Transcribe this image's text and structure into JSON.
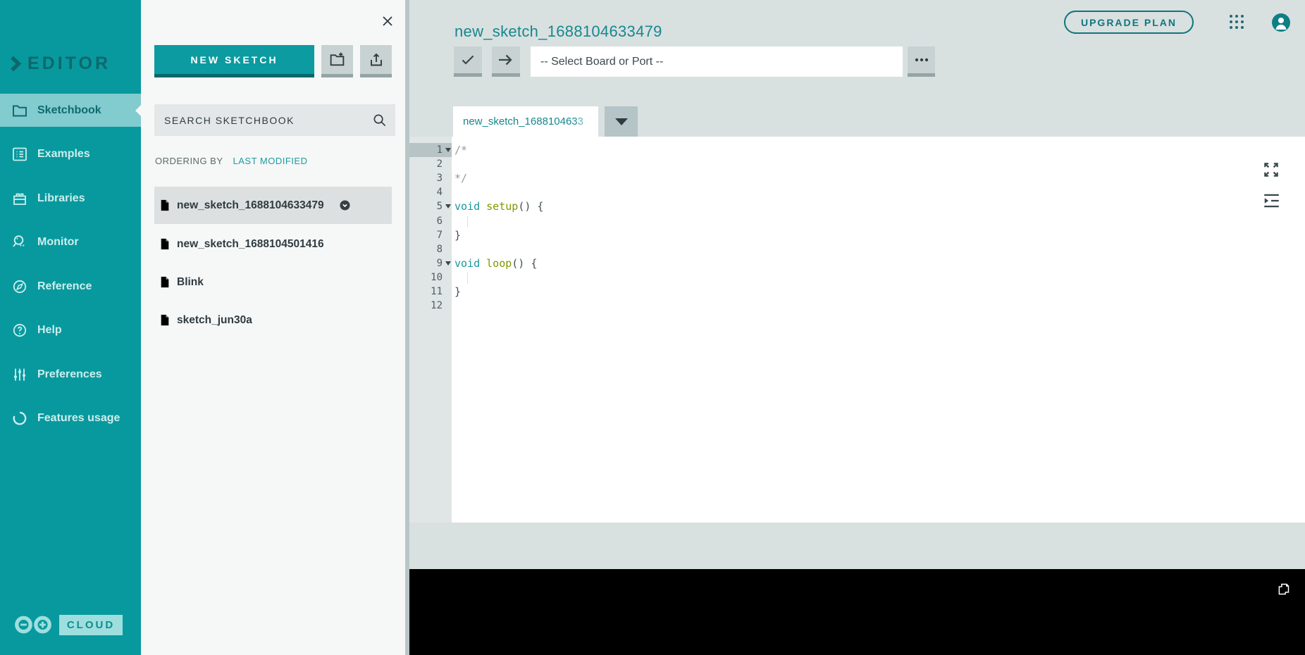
{
  "colors": {
    "sidebar_teal": "#08999e",
    "brand_teal": "#0b9ba0",
    "title_teal": "#16888d",
    "active_item_bg": "#82cbce",
    "main_bg": "#d9e0e0",
    "panel_bg": "#f6f7f7",
    "button_gray": "#c8d2d2",
    "console_black": "#000000",
    "code_keyword": "#17989d",
    "code_function": "#7d9a00",
    "code_comment": "#929c9c",
    "code_punct": "#434f54"
  },
  "sidebar": {
    "logo_text": "EDITOR",
    "items": [
      {
        "label": "Sketchbook",
        "icon": "folder-icon",
        "active": true
      },
      {
        "label": "Examples",
        "icon": "examples-icon"
      },
      {
        "label": "Libraries",
        "icon": "libraries-icon"
      },
      {
        "label": "Monitor",
        "icon": "monitor-icon"
      },
      {
        "label": "Reference",
        "icon": "reference-icon"
      },
      {
        "label": "Help",
        "icon": "help-icon"
      },
      {
        "label": "Preferences",
        "icon": "preferences-icon"
      },
      {
        "label": "Features usage",
        "icon": "features-usage-icon"
      }
    ],
    "cloud_badge": "CLOUD"
  },
  "panel": {
    "new_sketch_label": "NEW SKETCH",
    "search_placeholder": "SEARCH SKETCHBOOK",
    "ordering_label": "ORDERING BY",
    "ordering_value": "LAST MODIFIED",
    "sketches": [
      {
        "name": "new_sketch_1688104633479",
        "selected": true
      },
      {
        "name": "new_sketch_1688104501416",
        "selected": false
      },
      {
        "name": "Blink",
        "selected": false
      },
      {
        "name": "sketch_jun30a",
        "selected": false
      }
    ]
  },
  "header": {
    "title": "new_sketch_1688104633479",
    "upgrade_label": "UPGRADE PLAN"
  },
  "toolbar": {
    "board_selector": "-- Select Board or Port --"
  },
  "tabs": {
    "active_label": "new_sketch_1688104633"
  },
  "editor": {
    "lines": [
      {
        "n": 1,
        "fold": true,
        "active_gutter": true,
        "tokens": [
          [
            "comment",
            "/*"
          ]
        ]
      },
      {
        "n": 2,
        "tokens": []
      },
      {
        "n": 3,
        "tokens": [
          [
            "comment",
            "*/"
          ]
        ]
      },
      {
        "n": 4,
        "tokens": []
      },
      {
        "n": 5,
        "fold": true,
        "tokens": [
          [
            "keyword",
            "void"
          ],
          [
            "punct",
            " "
          ],
          [
            "function",
            "setup"
          ],
          [
            "punct",
            "() {"
          ]
        ]
      },
      {
        "n": 6,
        "guide": true,
        "tokens": []
      },
      {
        "n": 7,
        "tokens": [
          [
            "punct",
            "}"
          ]
        ]
      },
      {
        "n": 8,
        "tokens": []
      },
      {
        "n": 9,
        "fold": true,
        "tokens": [
          [
            "keyword",
            "void"
          ],
          [
            "punct",
            " "
          ],
          [
            "function",
            "loop"
          ],
          [
            "punct",
            "() {"
          ]
        ]
      },
      {
        "n": 10,
        "guide": true,
        "tokens": []
      },
      {
        "n": 11,
        "tokens": [
          [
            "punct",
            "}"
          ]
        ]
      },
      {
        "n": 12,
        "tokens": []
      }
    ]
  }
}
